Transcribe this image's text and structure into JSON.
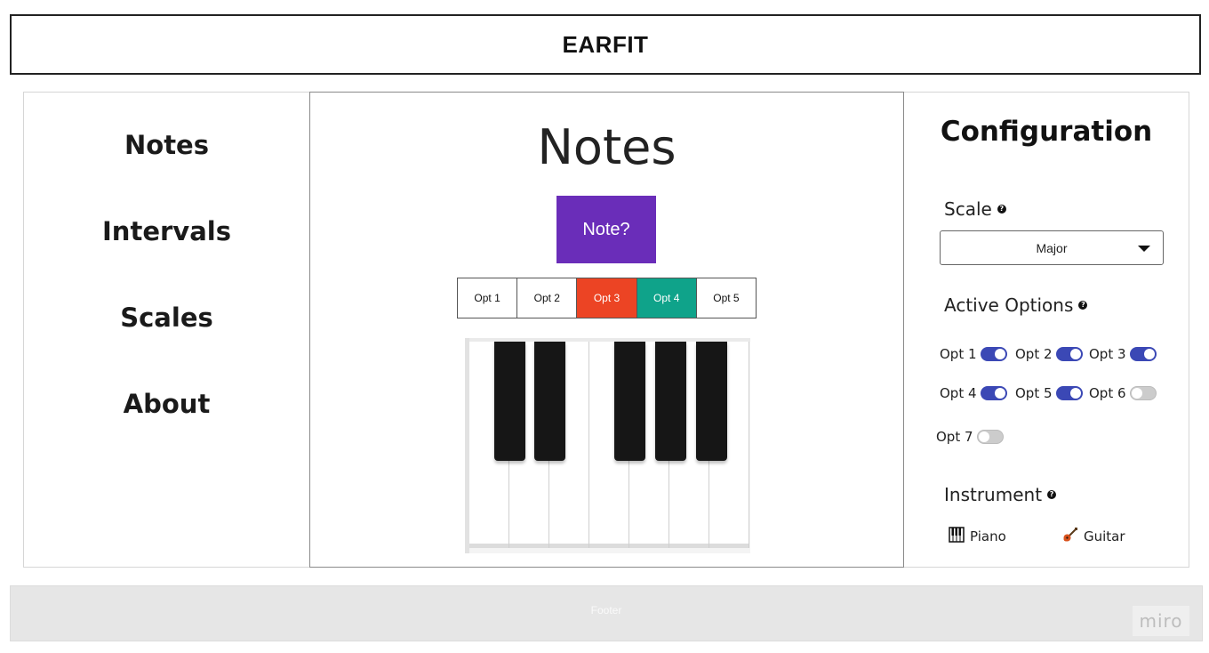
{
  "app": {
    "title": "EARFIT"
  },
  "sidebar": {
    "items": [
      {
        "label": "Notes"
      },
      {
        "label": "Intervals"
      },
      {
        "label": "Scales"
      },
      {
        "label": "About"
      }
    ]
  },
  "main": {
    "title": "Notes",
    "note_button": "Note?",
    "options": [
      {
        "label": "Opt 1",
        "state": "default"
      },
      {
        "label": "Opt 2",
        "state": "default"
      },
      {
        "label": "Opt 3",
        "state": "wrong"
      },
      {
        "label": "Opt 4",
        "state": "correct"
      },
      {
        "label": "Opt 5",
        "state": "default"
      }
    ],
    "piano": {
      "white_keys": 7,
      "black_keys": 5,
      "icon": "piano-keyboard"
    }
  },
  "config": {
    "title": "Configuration",
    "scale": {
      "label": "Scale",
      "help_icon": "help-icon",
      "selected": "Major"
    },
    "active_options": {
      "label": "Active Options",
      "help_icon": "help-icon",
      "items": [
        {
          "label": "Opt 1",
          "on": true
        },
        {
          "label": "Opt 2",
          "on": true
        },
        {
          "label": "Opt 3",
          "on": true
        },
        {
          "label": "Opt 4",
          "on": true
        },
        {
          "label": "Opt 5",
          "on": true
        },
        {
          "label": "Opt 6",
          "on": false
        },
        {
          "label": "Opt 7",
          "on": false
        }
      ]
    },
    "instrument": {
      "label": "Instrument",
      "help_icon": "help-icon",
      "options": [
        {
          "label": "Piano",
          "icon": "piano-icon"
        },
        {
          "label": "Guitar",
          "icon": "guitar-icon"
        }
      ]
    }
  },
  "footer": {
    "label": "Footer",
    "watermark": "miro"
  },
  "colors": {
    "note_button": "#6a2db9",
    "wrong": "#ec4424",
    "correct": "#0fa38a",
    "toggle_on": "#3b48b5",
    "toggle_off": "#cccccc",
    "footer_bg": "#e6e6e6"
  }
}
